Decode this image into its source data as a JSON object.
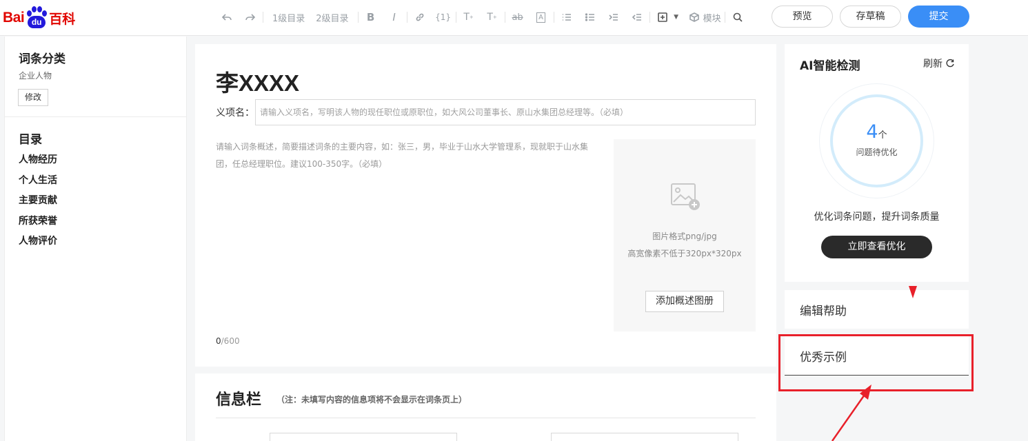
{
  "app": {
    "logo": {
      "left": "Bai",
      "paw": "du",
      "right": "百科"
    }
  },
  "toolbar": {
    "heading1": "1级目录",
    "heading2": "2级目录",
    "module": "模块",
    "icons": [
      "undo-icon",
      "redo-icon",
      "bold-icon",
      "italic-icon",
      "link-icon",
      "reference-icon",
      "superscript-icon",
      "subscript-icon",
      "strikethrough-icon",
      "letter-box-icon",
      "ordered-list-icon",
      "unordered-list-icon",
      "indent-icon",
      "outdent-icon",
      "insert-icon",
      "module-icon",
      "search-icon"
    ],
    "preview": "预览",
    "save_draft": "存草稿",
    "submit": "提交",
    "accent_color": "#3a8ef6"
  },
  "sidebar": {
    "category_title": "词条分类",
    "category_value": "企业人物",
    "edit_label": "修改",
    "toc_title": "目录",
    "toc_items": [
      "人物经历",
      "个人生活",
      "主要贡献",
      "所获荣誉",
      "人物评价"
    ]
  },
  "editor": {
    "title": "李XXXX",
    "yixiang_label": "义项名：",
    "yixiang_placeholder": "请输入义项名，写明该人物的现任职位或原职位，如大风公司董事长、原山水集团总经理等。（必填）",
    "summary_placeholder": "请输入词条概述，简要描述词条的主要内容，如：张三，男，毕业于山水大学管理系，现就职于山水集团，任总经理职位。建议100-350字。（必填）",
    "char_count": "0",
    "char_limit": "/600",
    "image_format": "图片格式png/jpg",
    "image_size": "高宽像素不低于320px*320px",
    "add_image": "添加概述图册"
  },
  "infobox": {
    "title": "信息栏",
    "note": "（注：未填写内容的信息项将不会显示在词条页上）"
  },
  "ai_panel": {
    "title": "AI智能检测",
    "refresh": "刷新",
    "count": "4",
    "count_unit": "个",
    "count_label": "问题待优化",
    "description": "优化词条问题，提升词条质量",
    "action": "立即查看优化"
  },
  "help": {
    "label": "编辑帮助"
  },
  "example": {
    "label": "优秀示例"
  },
  "annotation_color": "#e8202a"
}
